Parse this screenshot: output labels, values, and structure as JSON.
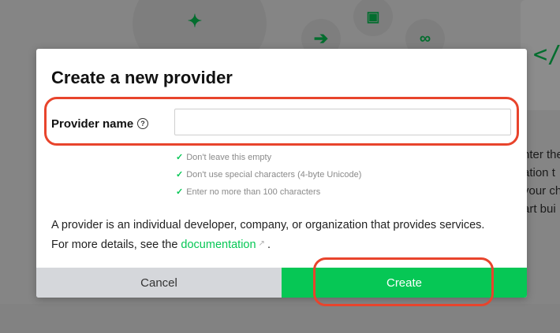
{
  "background": {
    "text_lines": [
      "nter the",
      "ation t",
      "your ch",
      "art bui"
    ],
    "code_glyph": "</"
  },
  "modal": {
    "title": "Create a new provider",
    "field_label": "Provider name",
    "help_glyph": "?",
    "input_value": "",
    "rules": [
      "Don't leave this empty",
      "Don't use special characters (4-byte Unicode)",
      "Enter no more than 100 characters"
    ],
    "check_glyph": "✓",
    "desc_before": "A provider is an individual developer, company, or organization that provides services. For more details, see the ",
    "desc_link": "documentation",
    "desc_after": ".",
    "cancel_label": "Cancel",
    "create_label": "Create"
  },
  "colors": {
    "accent": "#06c755",
    "annotation": "#e8442c",
    "cancel_bg": "#d5d7db"
  }
}
